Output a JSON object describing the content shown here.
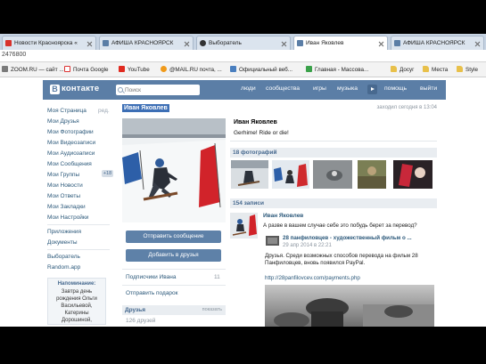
{
  "browser": {
    "tabs": [
      {
        "title": "Новости Красноярска «",
        "active": false
      },
      {
        "title": "АФИША КРАСНОЯРСК",
        "active": false
      },
      {
        "title": "Выборатель",
        "active": false
      },
      {
        "title": "Иван Яковлев",
        "active": true
      },
      {
        "title": "АФИША КРАСНОЯРСК",
        "active": false
      }
    ],
    "address": "2476800",
    "bookmarks": [
      {
        "label": "ZOOM.RU — сайт ...",
        "icon": "zoom-favicon-icon"
      },
      {
        "label": "Почта Google",
        "icon": "gmail-icon"
      },
      {
        "label": "YouTube",
        "icon": "youtube-icon"
      },
      {
        "label": "@MAIL.RU почта, ...",
        "icon": "mail-ru-icon"
      },
      {
        "label": "Официальный веб...",
        "icon": "website-icon"
      },
      {
        "label": "Главная - Массова...",
        "icon": "website-icon"
      },
      {
        "label": "Досуг",
        "icon": "folder-icon"
      },
      {
        "label": "Места",
        "icon": "folder-icon"
      },
      {
        "label": "Style",
        "icon": "folder-icon"
      }
    ]
  },
  "vk": {
    "logo_letter": "В",
    "logo_text": "контакте",
    "search_placeholder": "Поиск",
    "nav": [
      "люди",
      "сообщества",
      "игры",
      "музыка",
      "помощь",
      "выйти"
    ]
  },
  "sidebar": {
    "menu": [
      {
        "label": "Моя Страница",
        "extra": "ред."
      },
      {
        "label": "Мои Друзья"
      },
      {
        "label": "Мои Фотографии"
      },
      {
        "label": "Мои Видеозаписи"
      },
      {
        "label": "Мои Аудиозаписи"
      },
      {
        "label": "Мои Сообщения"
      },
      {
        "label": "Мои Группы",
        "badge": "+18"
      },
      {
        "label": "Мои Новости"
      },
      {
        "label": "Мои Ответы"
      },
      {
        "label": "Мои Закладки"
      },
      {
        "label": "Мои Настройки"
      }
    ],
    "apps": [
      "Приложения",
      "Документы"
    ],
    "user_apps": [
      "Выборатель",
      "Random.app"
    ],
    "reminder": {
      "title": "Напоминание:",
      "text": "Завтра день рождения Ольги Васильевой, Катерины Дорошиной,"
    }
  },
  "profile": {
    "name": "Иван Яковлев",
    "last_seen": "заходил сегодня в 13:04",
    "status": "Gerhime! Ride or die!",
    "send_message": "Отправить сообщение",
    "add_friend": "Добавить в друзья",
    "followers_label": "Подписчики Ивана",
    "followers_count": "11",
    "send_gift": "Отправить подарок",
    "friends_header": "Друзья",
    "friends_more": "показать",
    "friends_count": "126 друзей",
    "photos_header": "18 фотографий",
    "posts_header": "154 записи"
  },
  "wall": {
    "post": {
      "author": "Иван Яковлев",
      "text": "А разве в вашем случае себе это побудь берет за перевод?",
      "repost_title": "28 панфиловцев - художественный фильм о ...",
      "repost_date": "29 апр 2014 в 22:21",
      "body": "Друзья. Среди возможных способов перевода на фильм 28 Панфиловцев, вновь появился PayPal.",
      "link": "http://28panfilovcev.com/payments.php"
    }
  },
  "colors": {
    "vk_header": "#5b7ea6",
    "link": "#2b587a",
    "button": "#5e81a8",
    "section_bg": "#e9edf1",
    "selection": "#3d6fb5"
  }
}
